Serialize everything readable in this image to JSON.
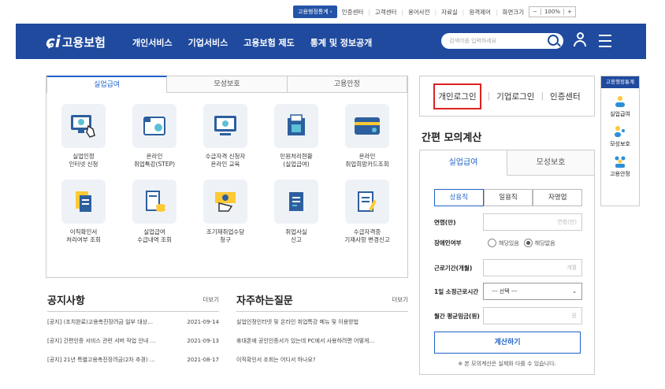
{
  "util": {
    "stats_button": "고용행정통계 ›",
    "links": [
      "인증센터",
      "고객센터",
      "용어사전",
      "자료실",
      "원격제어",
      "화면크기"
    ],
    "zoom_minus": "−",
    "zoom_value": "100%",
    "zoom_plus": "+"
  },
  "nav": {
    "logo_text": "고용보험",
    "menu": [
      "개인서비스",
      "기업서비스",
      "고용보험 제도",
      "통계 및 정보공개"
    ],
    "search_placeholder": "검색어를 입력하세요"
  },
  "tabs": [
    "실업급여",
    "모성보호",
    "고용안정"
  ],
  "services": [
    {
      "label": "실업인정\n인터넷 신청",
      "icon": "monitor-hand-icon"
    },
    {
      "label": "온라인\n취업특강(STEP)",
      "icon": "projector-icon"
    },
    {
      "label": "수급자격 신청자\n온라인 교육",
      "icon": "video-monitor-icon"
    },
    {
      "label": "민원처리현황\n(실업급여)",
      "icon": "folder-doc-icon"
    },
    {
      "label": "온라인\n취업희망카드조회",
      "icon": "card-icon"
    },
    {
      "label": "이직확인서\n처리여부 조회",
      "icon": "documents-icon"
    },
    {
      "label": "실업급여\n수급내역 조회",
      "icon": "receipt-coins-icon"
    },
    {
      "label": "조기재취업수당\n청구",
      "icon": "money-hand-icon"
    },
    {
      "label": "취업사실\n신고",
      "icon": "doc-edit-icon"
    },
    {
      "label": "수급자격증\n기재사항 변경신고",
      "icon": "doc-pen-icon"
    }
  ],
  "notice": {
    "title": "공지사항",
    "more": "더보기",
    "items": [
      {
        "text": "[공지] (조치완료)고용촉진장려금 일부 대상…",
        "date": "2021-09-14"
      },
      {
        "text": "[공지] 간편인증 서비스 관련 서버 작업 안내 …",
        "date": "2021-09-13"
      },
      {
        "text": "[공지] 21년 특별고용촉진장려금(2차 추경) …",
        "date": "2021-08-17"
      }
    ]
  },
  "faq": {
    "title": "자주하는질문",
    "more": "더보기",
    "items": [
      "실업인정인터넷 및 온라인 취업특강 메뉴 및 이용방법",
      "휴대폰에 공인인증서가 있는데 PC에서 사용하려면 어떻게…",
      "이직확인서 조회는 어디서 하나요?"
    ]
  },
  "login": {
    "personal": "개인로그인",
    "business": "기업로그인",
    "cert": "인증센터"
  },
  "calc": {
    "title": "간편 모의계산",
    "tabs": [
      "실업급여",
      "모성보호"
    ],
    "segments": [
      "상용직",
      "일용직",
      "자영업"
    ],
    "age_label": "연령(만)",
    "age_placeholder": "연령(만)",
    "disability_label": "장애인여부",
    "disability_yes": "해당있음",
    "disability_no": "해당없음",
    "period_label": "근로기간(개월)",
    "period_placeholder": "개월",
    "hours_label": "1일 소정근로시간",
    "hours_value": "--- 선택 ---",
    "wage_label": "월간 평균임금(원)",
    "wage_placeholder": "원",
    "button": "계산하기",
    "note": "※ 본 모의계산은 실제와 다를 수 있습니다."
  },
  "side": {
    "header": "고용행정통계",
    "items": [
      "실업급여",
      "모성보호",
      "고용안정"
    ]
  }
}
